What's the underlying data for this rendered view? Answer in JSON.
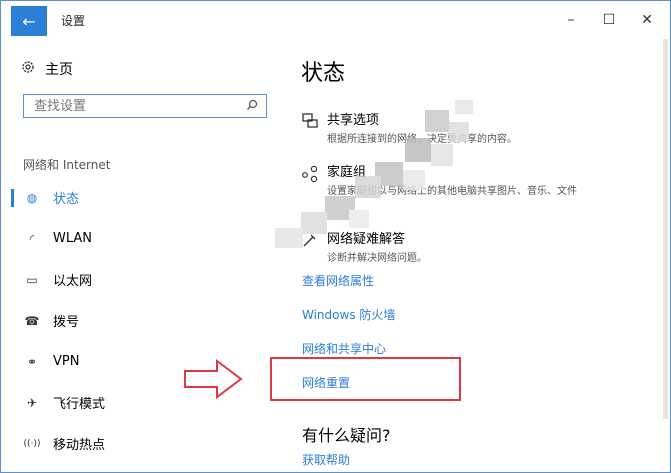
{
  "window": {
    "title": "设置",
    "back_icon": "←",
    "minimize_icon": "–",
    "maximize_icon": "☐",
    "close_icon": "✕"
  },
  "sidebar": {
    "home_label": "主页",
    "search_placeholder": "查找设置",
    "section_label": "网络和 Internet",
    "items": [
      {
        "label": "状态",
        "icon": "globe-icon",
        "glyph": "◍",
        "active": true
      },
      {
        "label": "WLAN",
        "icon": "wifi-icon",
        "glyph": "◜",
        "active": false
      },
      {
        "label": "以太网",
        "icon": "ethernet-icon",
        "glyph": "▭",
        "active": false
      },
      {
        "label": "拨号",
        "icon": "dialup-icon",
        "glyph": "☎",
        "active": false
      },
      {
        "label": "VPN",
        "icon": "vpn-icon",
        "glyph": "⚭",
        "active": false
      },
      {
        "label": "飞行模式",
        "icon": "airplane-icon",
        "glyph": "✈",
        "active": false
      },
      {
        "label": "移动热点",
        "icon": "hotspot-icon",
        "glyph": "((·))",
        "active": false
      }
    ]
  },
  "main": {
    "title": "状态",
    "options": [
      {
        "title": "共享选项",
        "desc": "根据所连接到的网络，决定要共享的内容。",
        "icon": "share-options-icon"
      },
      {
        "title": "家庭组",
        "desc": "设置家庭组以与网络上的其他电脑共享图片、音乐、文件",
        "icon": "homegroup-icon"
      },
      {
        "title": "网络疑难解答",
        "desc": "诊断并解决网络问题。",
        "icon": "troubleshoot-icon"
      }
    ],
    "links": [
      "查看网络属性",
      "Windows 防火墙",
      "网络和共享中心",
      "网络重置"
    ],
    "help_heading": "有什么疑问?",
    "help_link": "获取帮助"
  },
  "colors": {
    "accent": "#2b7fd6",
    "highlight": "#e0383e"
  }
}
